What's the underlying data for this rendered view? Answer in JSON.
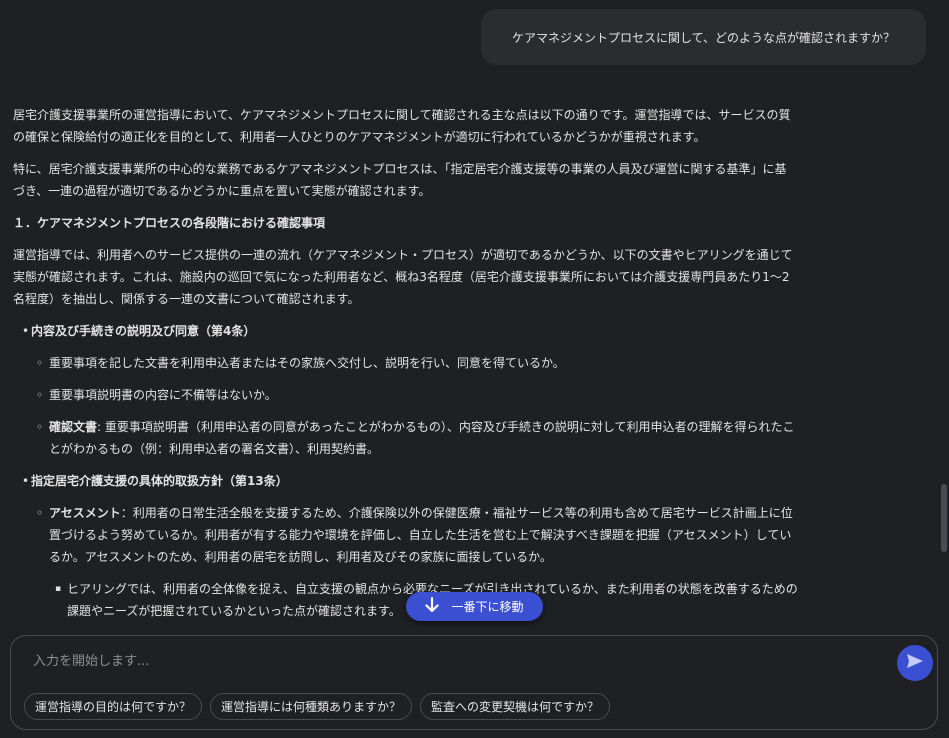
{
  "user_message": "ケアマネジメントプロセスに関して、どのような点が確認されますか？",
  "answer": {
    "p1": "居宅介護支援事業所の運営指導において、ケアマネジメントプロセスに関して確認される主な点は以下の通りです。運営指導では、サービスの質の確保と保険給付の適正化を目的として、利用者一人ひとりのケアマネジメントが適切に行われているかどうかが重視されます。",
    "p2": "特に、居宅介護支援事業所の中心的な業務であるケアマネジメントプロセスは、「指定居宅介護支援等の事業の人員及び運営に関する基準」に基づき、一連の過程が適切であるかどうかに重点を置いて実態が確認されます。",
    "heading1": "１．ケアマネジメントプロセスの各段階における確認事項",
    "p3": "運営指導では、利用者へのサービス提供の一連の流れ（ケアマネジメント・プロセス）が適切であるかどうか、以下の文書やヒアリングを通じて実態が確認されます。これは、施設内の巡回で気になった利用者など、概ね3名程度（居宅介護支援事業所においては介護支援専門員あたり1〜2名程度）を抽出し、関係する一連の文書について確認されます。",
    "bullet1": "内容及び手続きの説明及び同意（第4条）",
    "b1_s1": "重要事項を記した文書を利用申込者またはその家族へ交付し、説明を行い、同意を得ているか。",
    "b1_s2": "重要事項説明書の内容に不備等はないか。",
    "b1_s3_label": "確認文書",
    "b1_s3_text": ": 重要事項説明書（利用申込者の同意があったことがわかるもの）、内容及び手続きの説明に対して利用申込者の理解を得られたことがわかるもの（例：利用申込者の署名文書）、利用契約書。",
    "bullet2": "指定居宅介護支援の具体的取扱方針（第13条）",
    "b2_s1_label": "アセスメント",
    "b2_s1_text": "：利用者の日常生活全般を支援するため、介護保険以外の保健医療・福祉サービス等の利用も含めて居宅サービス計画上に位置づけるよう努めているか。利用者が有する能力や環境を評価し、自立した生活を営む上で解決すべき課題を把握（アセスメント）しているか。アセスメントのため、利用者の居宅を訪問し、利用者及びその家族に面接しているか。",
    "b2_ss1": "ヒアリングでは、利用者の全体像を捉え、自立支援の観点から必要なニーズが引き出されているか、また利用者の状態を改善するための課題やニーズが把握されているかといった点が確認されます。"
  },
  "scroll_down_label": "一番下に移動",
  "input": {
    "placeholder": "入力を開始します...",
    "value": ""
  },
  "suggestions": [
    "運営指導の目的は何ですか？",
    "運営指導には何種類ありますか？",
    "監査への変更契機は何ですか？"
  ],
  "colors": {
    "background": "#1f2024",
    "accent": "#3b4fd3",
    "bubble": "#2b2c30"
  },
  "icons": {
    "scroll_down": "arrow-down-icon",
    "send": "send-icon"
  }
}
